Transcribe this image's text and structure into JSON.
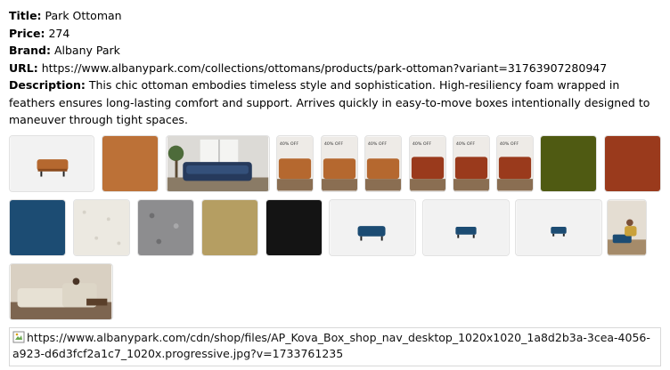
{
  "product": {
    "title_label": "Title:",
    "title": "Park Ottoman",
    "price_label": "Price:",
    "price": "274",
    "brand_label": "Brand:",
    "brand": "Albany Park",
    "url_label": "URL:",
    "url": "https://www.albanypark.com/collections/ottomans/products/park-ottoman?variant=31763907280947",
    "description_label": "Description:",
    "description": "This chic ottoman embodies timeless style and sophistication. High-resiliency foam wrapped in feathers ensures long-lasting comfort and support. Arrives quickly in easy-to-move boxes intentionally designed to maneuver through tight spaces."
  },
  "gallery": {
    "sale_badge": "40% OFF",
    "images": [
      {
        "name": "ottoman-cognac-product-image",
        "icon": "ottoman-photo"
      },
      {
        "name": "cognac-leather-swatch-image",
        "icon": "swatch"
      },
      {
        "name": "blue-sofa-living-room-image",
        "icon": "room-photo"
      },
      {
        "name": "cognac-sofa-sale-image-1",
        "icon": "sale-photo"
      },
      {
        "name": "cognac-sofa-sale-image-2",
        "icon": "sale-photo"
      },
      {
        "name": "cognac-sofa-sale-image-3",
        "icon": "sale-photo"
      },
      {
        "name": "rust-sofa-sale-image-1",
        "icon": "sale-photo"
      },
      {
        "name": "rust-sofa-sale-image-2",
        "icon": "sale-photo"
      },
      {
        "name": "rust-sofa-sale-image-3",
        "icon": "sale-photo"
      },
      {
        "name": "olive-swatch-image",
        "icon": "swatch"
      },
      {
        "name": "rust-swatch-image",
        "icon": "swatch"
      },
      {
        "name": "navy-swatch-image",
        "icon": "swatch"
      },
      {
        "name": "ivory-boucle-swatch-image",
        "icon": "swatch"
      },
      {
        "name": "grey-tweed-swatch-image",
        "icon": "swatch"
      },
      {
        "name": "gold-swatch-image",
        "icon": "swatch"
      },
      {
        "name": "black-swatch-image",
        "icon": "swatch"
      },
      {
        "name": "ottoman-navy-product-image-1",
        "icon": "ottoman-photo"
      },
      {
        "name": "ottoman-navy-product-image-2",
        "icon": "ottoman-photo"
      },
      {
        "name": "ottoman-navy-product-image-3",
        "icon": "ottoman-photo"
      },
      {
        "name": "person-on-ottoman-image",
        "icon": "lifestyle-photo"
      },
      {
        "name": "sectional-living-room-image",
        "icon": "room-photo"
      }
    ],
    "colors": {
      "cognac": "#b5682f",
      "olive": "#4f5a12",
      "rust": "#9a3a1c",
      "navy": "#1c4c73",
      "ivory": "#ece9e1",
      "grey": "#8d8d8f",
      "gold": "#b59e62",
      "black": "#141414",
      "thumb_bg": "#f2f2f2"
    }
  },
  "broken_image": {
    "icon": "broken-image-icon",
    "alt_text": "https://www.albanypark.com/cdn/shop/files/AP_Kova_Box_shop_nav_desktop_1020x1020_1a8d2b3a-3cea-4056-a923-d6d3fcf2a1c7_1020x.progressive.jpg?v=1733761235"
  }
}
